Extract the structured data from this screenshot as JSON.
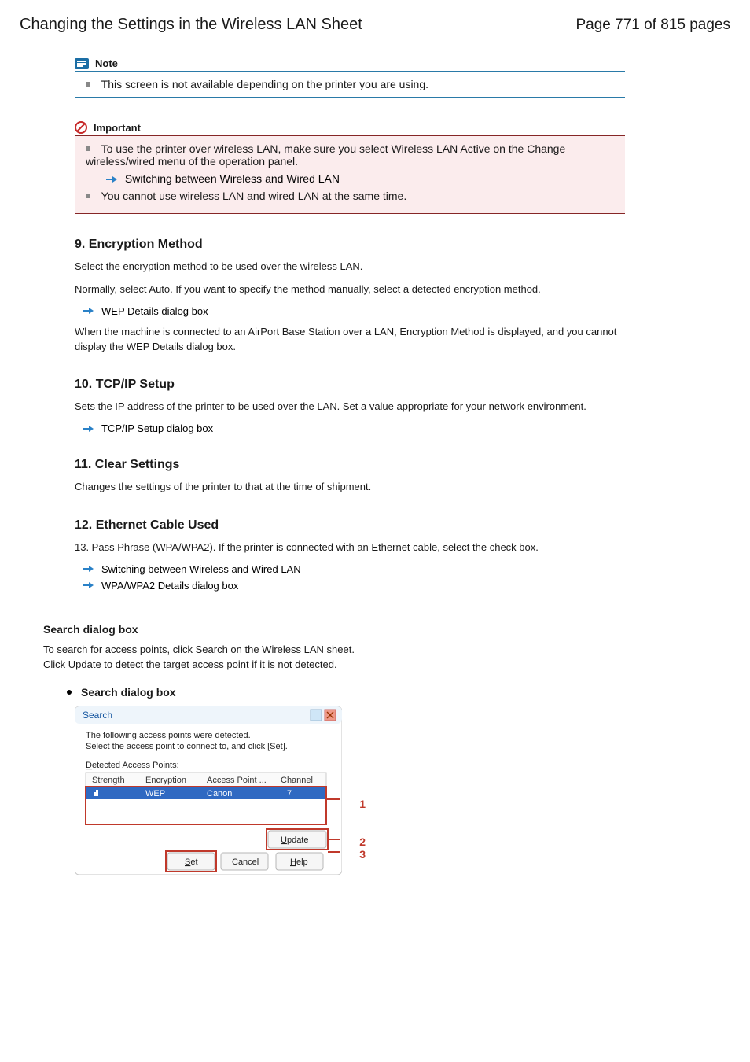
{
  "header": {
    "title": "Changing the Settings in the Wireless LAN Sheet",
    "page": "Page 771 of 815 pages"
  },
  "note": {
    "label": "Note",
    "body": "This screen is not available depending on the printer you are using."
  },
  "important": {
    "label": "Important",
    "body1": "To use the printer over wireless LAN, make sure you select Wireless LAN Active on the Change wireless/wired menu of the operation panel.",
    "link_label": "Switching between Wireless and Wired LAN",
    "body2": "You cannot use wireless LAN and wired LAN at the same time."
  },
  "items": {
    "h9": "9. Encryption Method",
    "p9a": "Select the encryption method to be used over the wireless LAN.",
    "p9b": "Normally, select Auto. If you want to specify the method manually, select a detected encryption method.",
    "a9": "WEP Details dialog box",
    "p9c": "When the machine is connected to an AirPort Base Station over a LAN, Encryption Method is displayed, and you cannot display the WEP Details dialog box.",
    "h10": "10. TCP/IP Setup",
    "p10a": "Sets the IP address of the printer to be used over the LAN. Set a value appropriate for your network environment.",
    "a10": "TCP/IP Setup dialog box",
    "h11": "11. Clear Settings",
    "p11": "Changes the settings of the printer to that at the time of shipment.",
    "h12": "12. Ethernet Cable Used",
    "p12": "13. Pass Phrase (WPA/WPA2). If the printer is connected with an Ethernet cable, select the check box.",
    "a12a": "Switching between Wireless and Wired LAN",
    "a12b": "WPA/WPA2 Details dialog box"
  },
  "searchSection": {
    "heading": "Search dialog box",
    "sub1": "To search for access points, click Search on the Wireless LAN sheet.",
    "sub2": "Click Update to detect the target access point if it is not detected.",
    "bullet": "Search dialog box",
    "callouts": {
      "n1": "1",
      "n2": "2",
      "n3": "3"
    }
  }
}
